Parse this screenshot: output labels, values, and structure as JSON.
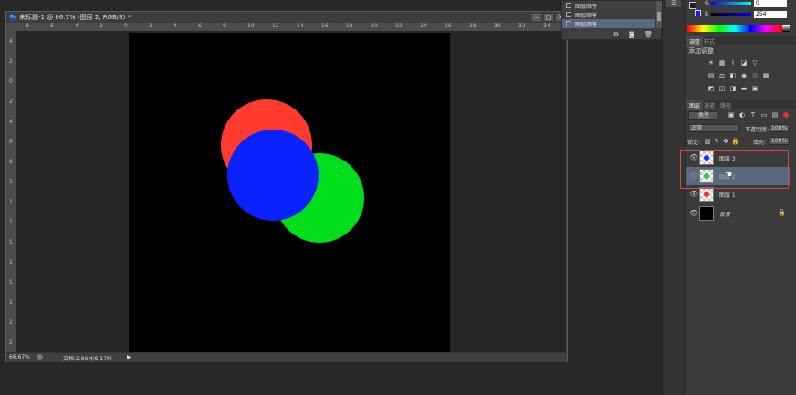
{
  "document": {
    "title": "未标题-1 @ 66.7% (图层 2, RGB/8) *",
    "app_badge": "Ps",
    "minimize": "–",
    "restore": "▢",
    "close": "✕"
  },
  "ruler_h": [
    "8",
    "6",
    "4",
    "2",
    "0",
    "2",
    "4",
    "6",
    "8",
    "10",
    "12",
    "14",
    "16",
    "18",
    "20",
    "22",
    "24",
    "26",
    "28",
    "30",
    "32",
    "34"
  ],
  "ruler_v": [
    "4",
    "2",
    "0",
    "2",
    "4",
    "6",
    "8",
    "1",
    "1",
    "1",
    "1",
    "1",
    "1",
    "1",
    "2",
    "2"
  ],
  "canvas": {
    "background": "#000000",
    "circles": [
      {
        "layer": "图层 1",
        "color": "#ff3b2f"
      },
      {
        "layer": "图层 2",
        "color": "#00dd1a"
      },
      {
        "layer": "图层 3",
        "color": "#0a22ff"
      }
    ]
  },
  "status": {
    "zoom": "66.67%",
    "doc": "文档:2.86M/6.17M",
    "arrow": "▶"
  },
  "history": {
    "items": [
      "图层顺序",
      "图层顺序",
      "图层顺序"
    ],
    "selected_index": 2
  },
  "color_panel": {
    "g_label": "G",
    "g_value": "0",
    "b_label": "B",
    "b_value": "254"
  },
  "adjustments": {
    "tabs": [
      "调整",
      "样式"
    ],
    "title": "添加调整"
  },
  "layers": {
    "tabs": [
      "图层",
      "通道",
      "路径"
    ],
    "filter_kind": "类型",
    "blend_mode": "正常",
    "opacity_label": "不透明度:",
    "opacity_value": "100%",
    "lock_label": "锁定:",
    "fill_label": "填充:",
    "fill_value": "100%",
    "items": [
      {
        "name": "图层 3",
        "dot": "#1232ff",
        "selected": false
      },
      {
        "name": "图层 2",
        "dot": "#1ed23a",
        "selected": true
      },
      {
        "name": "图层 1",
        "dot": "#ff2a2a",
        "selected": false
      },
      {
        "name": "背景",
        "dot": null,
        "selected": false
      }
    ]
  },
  "colors": {
    "selection": "#5a6a7e",
    "highlight_box": "#d24a4a"
  }
}
